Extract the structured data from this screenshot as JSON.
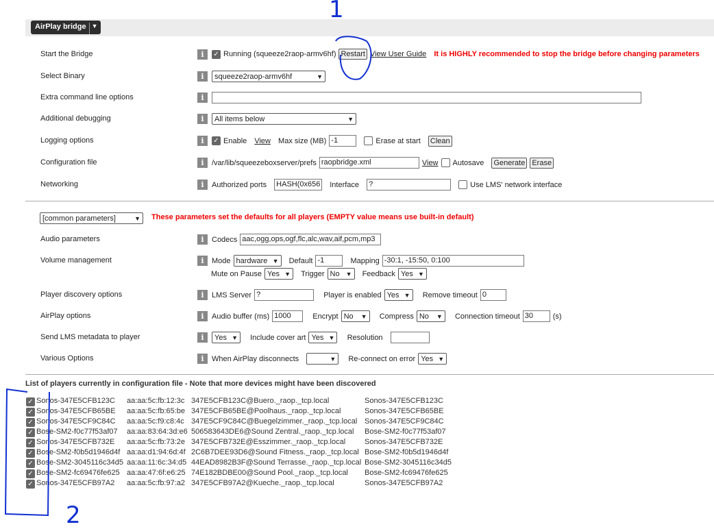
{
  "plugin_button": "AirPlay bridge",
  "bridge": {
    "start": {
      "label": "Start the Bridge",
      "checked": true,
      "status": "Running (squeeze2raop-armv6hf)",
      "restart": "Restart",
      "guide": "View User Guide",
      "warning": "It is HIGHLY recommended to stop the bridge before changing parameters"
    },
    "binary": {
      "label": "Select Binary",
      "value": "squeeze2raop-armv6hf"
    },
    "extra": {
      "label": "Extra command line options",
      "value": ""
    },
    "debug": {
      "label": "Additional debugging",
      "value": "All items below"
    },
    "logging": {
      "label": "Logging options",
      "enable": "Enable",
      "view": "View",
      "maxsize_label": "Max size (MB)",
      "maxsize": "-1",
      "erase": "Erase at start",
      "clean": "Clean"
    },
    "config": {
      "label": "Configuration file",
      "path": "/var/lib/squeezeboxserver/prefs",
      "file": "raopbridge.xml",
      "view": "View",
      "autosave": "Autosave",
      "generate": "Generate",
      "erase": "Erase"
    },
    "network": {
      "label": "Networking",
      "ports_label": "Authorized ports",
      "ports": "HASH(0x656",
      "iface_label": "Interface",
      "iface": "?",
      "lms_iface": "Use LMS' network interface"
    }
  },
  "params": {
    "selector": "[common parameters]",
    "note": "These parameters set the defaults for all players (EMPTY value means use built-in default)",
    "audio": {
      "label": "Audio parameters",
      "codecs_label": "Codecs",
      "codecs": "aac,ogg,ops,ogf,flc,alc,wav,aif,pcm,mp3"
    },
    "volume": {
      "label": "Volume management",
      "mode_label": "Mode",
      "mode": "hardware",
      "default_label": "Default",
      "default": "-1",
      "mapping_label": "Mapping",
      "mapping": "-30:1, -15:50, 0:100",
      "mute_label": "Mute on Pause",
      "mute": "Yes",
      "trigger_label": "Trigger",
      "trigger": "No",
      "feedback_label": "Feedback",
      "feedback": "Yes"
    },
    "discovery": {
      "label": "Player discovery options",
      "lms_label": "LMS Server",
      "lms": "?",
      "enabled_label": "Player is enabled",
      "enabled": "Yes",
      "timeout_label": "Remove timeout",
      "timeout": "0"
    },
    "airplay": {
      "label": "AirPlay options",
      "buffer_label": "Audio buffer (ms)",
      "buffer": "1000",
      "encrypt_label": "Encrypt",
      "encrypt": "No",
      "compress_label": "Compress",
      "compress": "No",
      "conn_label": "Connection timeout",
      "conn": "30",
      "conn_unit": "(s)"
    },
    "metadata": {
      "label": "Send LMS metadata to player",
      "value": "Yes",
      "cover_label": "Include cover art",
      "cover": "Yes",
      "res_label": "Resolution",
      "res": ""
    },
    "various": {
      "label": "Various Options",
      "disc_label": "When AirPlay disconnects",
      "disc": "",
      "reconn_label": "Re-connect on error",
      "reconn": "Yes"
    }
  },
  "players_title": "List of players currently in configuration file - Note that more devices might have been discovered",
  "players": [
    [
      "Sonos-347E5CFB123C",
      "aa:aa:5c:fb:12:3c",
      "347E5CFB123C@Buero._raop._tcp.local",
      "Sonos-347E5CFB123C"
    ],
    [
      "Sonos-347E5CFB65BE",
      "aa:aa:5c:fb:65:be",
      "347E5CFB65BE@Poolhaus._raop._tcp.local",
      "Sonos-347E5CFB65BE"
    ],
    [
      "Sonos-347E5CF9C84C",
      "aa:aa:5c:f9:c8:4c",
      "347E5CF9C84C@Buegelzimmer._raop._tcp.local",
      "Sonos-347E5CF9C84C"
    ],
    [
      "Bose-SM2-f0c77f53af07",
      "aa:aa:83:64:3d:e6",
      "506583643DE6@Sound Zentral._raop._tcp.local",
      "Bose-SM2-f0c77f53af07"
    ],
    [
      "Sonos-347E5CFB732E",
      "aa:aa:5c:fb:73:2e",
      "347E5CFB732E@Esszimmer._raop._tcp.local",
      "Sonos-347E5CFB732E"
    ],
    [
      "Bose-SM2-f0b5d1946d4f",
      "aa:aa:d1:94:6d:4f",
      "2C6B7DEE93D6@Sound Fitness._raop._tcp.local",
      "Bose-SM2-f0b5d1946d4f"
    ],
    [
      "Bose-SM2-3045116c34d5",
      "aa:aa:11:6c:34:d5",
      "44EAD8982B3F@Sound Terrasse._raop._tcp.local",
      "Bose-SM2-3045116c34d5"
    ],
    [
      "Bose-SM2-fc69476fe625",
      "aa:aa:47:6f:e6:25",
      "74E182BDBE00@Sound Pool._raop._tcp.local",
      "Bose-SM2-fc69476fe625"
    ],
    [
      "Sonos-347E5CFB97A2",
      "aa:aa:5c:fb:97:a2",
      "347E5CFB97A2@Kueche._raop._tcp.local",
      "Sonos-347E5CFB97A2"
    ]
  ],
  "annotations": {
    "one": "1",
    "two": "2",
    "color": "#1030d0"
  }
}
